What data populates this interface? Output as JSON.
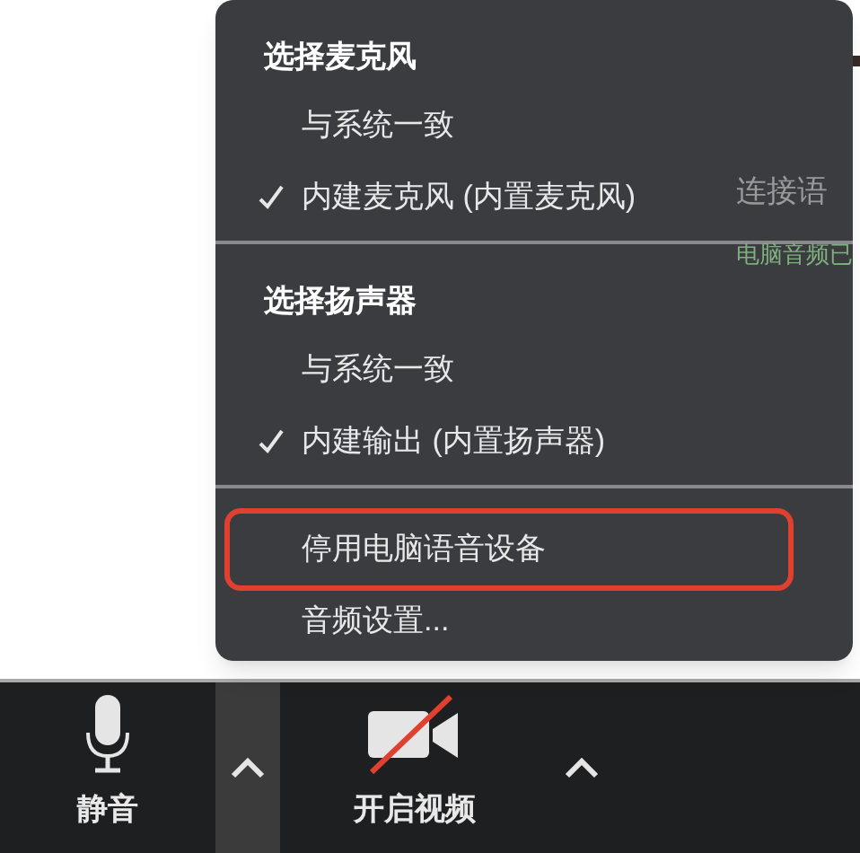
{
  "background": {
    "texts": [
      "连接语",
      "电脑音频已"
    ]
  },
  "menu": {
    "sections": [
      {
        "header": "选择麦克风",
        "items": [
          {
            "label": "与系统一致",
            "checked": false,
            "outlined": false
          },
          {
            "label": "内建麦克风 (内置麦克风)",
            "checked": true,
            "outlined": false
          }
        ]
      },
      {
        "header": "选择扬声器",
        "items": [
          {
            "label": "与系统一致",
            "checked": false,
            "outlined": false
          },
          {
            "label": "内建输出 (内置扬声器)",
            "checked": true,
            "outlined": false
          }
        ]
      },
      {
        "items": [
          {
            "label": "停用电脑语音设备",
            "checked": false,
            "outlined": true
          },
          {
            "label": "音频设置...",
            "checked": false,
            "outlined": false
          }
        ]
      }
    ]
  },
  "toolbar": {
    "buttons": [
      {
        "kind": "mic",
        "label": "静音",
        "caret_selected": true
      },
      {
        "kind": "video",
        "label": "开启视频",
        "caret_selected": false
      }
    ]
  }
}
